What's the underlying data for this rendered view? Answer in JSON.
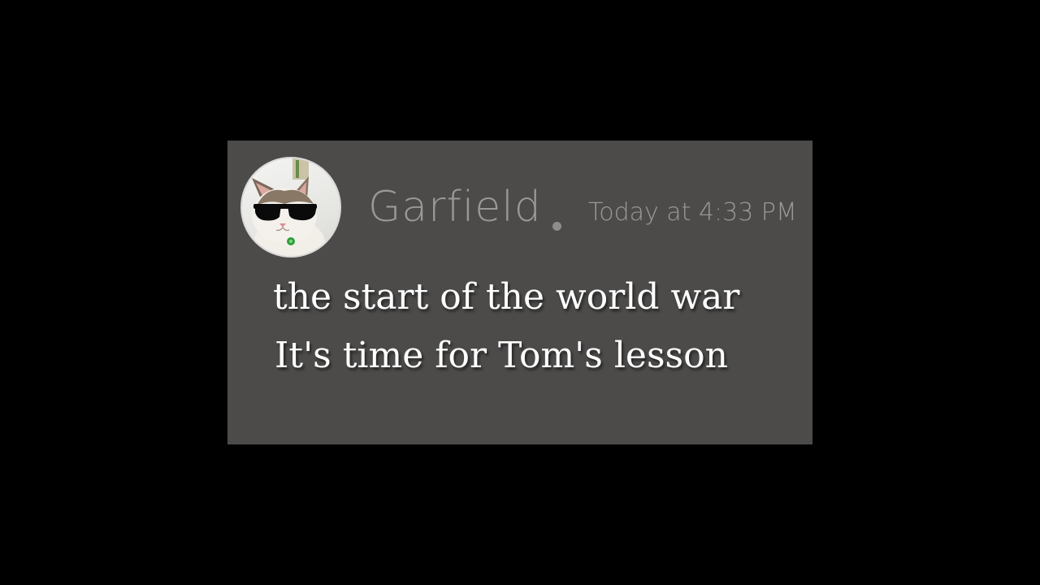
{
  "message": {
    "author": "Garfield",
    "timestamp": "Today at 4:33 PM",
    "lines": [
      "the start of the world war",
      "It's time for Tom's lesson"
    ]
  },
  "avatar": {
    "icon": "cat-with-sunglasses-avatar"
  },
  "colors": {
    "background": "#000000",
    "card": "#4c4b4a",
    "meta_text": "#9a9997",
    "message_text": "#ffffff"
  }
}
